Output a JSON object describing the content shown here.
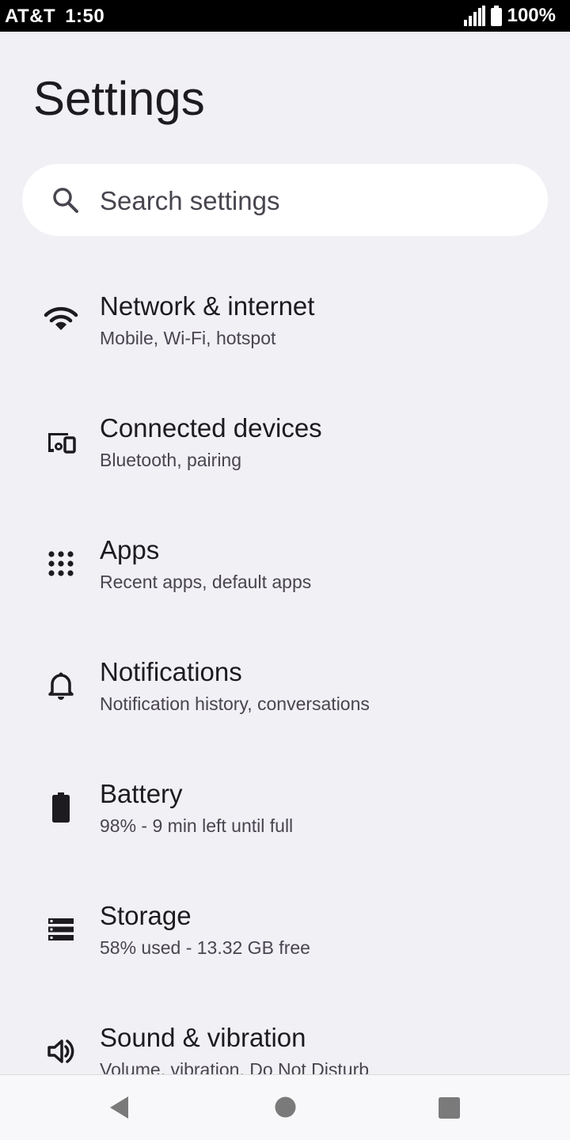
{
  "status_bar": {
    "carrier": "AT&T",
    "time": "1:50",
    "battery": "100%"
  },
  "page": {
    "title": "Settings"
  },
  "search": {
    "placeholder": "Search settings"
  },
  "items": [
    {
      "title": "Network & internet",
      "subtitle": "Mobile, Wi-Fi, hotspot",
      "icon": "wifi-icon"
    },
    {
      "title": "Connected devices",
      "subtitle": "Bluetooth, pairing",
      "icon": "devices-icon"
    },
    {
      "title": "Apps",
      "subtitle": "Recent apps, default apps",
      "icon": "apps-grid-icon"
    },
    {
      "title": "Notifications",
      "subtitle": "Notification history, conversations",
      "icon": "bell-icon"
    },
    {
      "title": "Battery",
      "subtitle": "98% - 9 min left until full",
      "icon": "battery-icon"
    },
    {
      "title": "Storage",
      "subtitle": "58% used - 13.32 GB free",
      "icon": "storage-icon"
    },
    {
      "title": "Sound & vibration",
      "subtitle": "Volume, vibration, Do Not Disturb",
      "icon": "speaker-icon"
    }
  ],
  "colors": {
    "background": "#f1f0f5",
    "text_primary": "#1d1b20",
    "text_secondary": "#49454f",
    "nav_icon": "#7a7a7a"
  }
}
